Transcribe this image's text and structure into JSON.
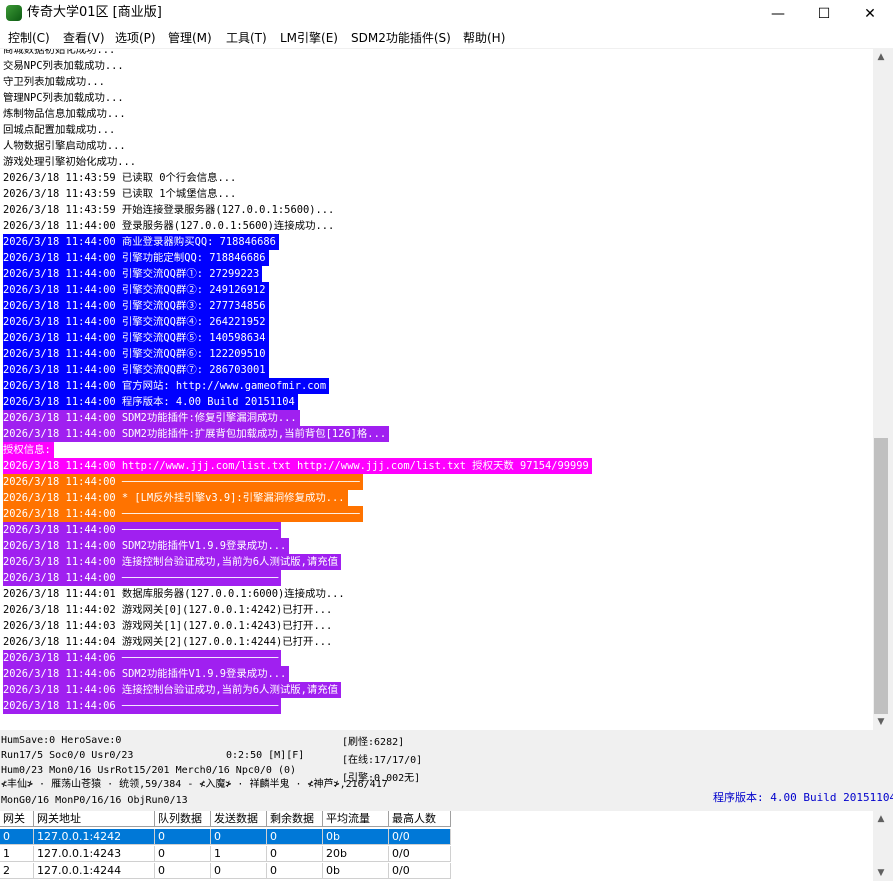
{
  "window": {
    "title": "传奇大学01区 [商业版]",
    "minimize": "—",
    "maximize": "☐",
    "close": "✕"
  },
  "menu": [
    {
      "label": "控制(C)"
    },
    {
      "label": "查看(V)"
    },
    {
      "label": "选项(P)"
    },
    {
      "label": "管理(M)"
    },
    {
      "label": "工具(T)"
    },
    {
      "label": "LM引擎(E)"
    },
    {
      "label": "SDM2功能插件(S)"
    },
    {
      "label": "帮助(H)"
    }
  ],
  "log": [
    {
      "text": "商城数据初始化成功...",
      "fg": "#000000",
      "bg": "#ffffff"
    },
    {
      "text": "交易NPC列表加载成功...",
      "fg": "#000000",
      "bg": "#ffffff"
    },
    {
      "text": "守卫列表加载成功...",
      "fg": "#000000",
      "bg": "#ffffff"
    },
    {
      "text": "管理NPC列表加载成功...",
      "fg": "#000000",
      "bg": "#ffffff"
    },
    {
      "text": "炼制物品信息加载成功...",
      "fg": "#000000",
      "bg": "#ffffff"
    },
    {
      "text": "回城点配置加载成功...",
      "fg": "#000000",
      "bg": "#ffffff"
    },
    {
      "text": "人物数据引擎启动成功...",
      "fg": "#000000",
      "bg": "#ffffff"
    },
    {
      "text": "游戏处理引擎初始化成功...",
      "fg": "#000000",
      "bg": "#ffffff"
    },
    {
      "text": "2026/3/18 11:43:59 已读取 0个行会信息...",
      "fg": "#000000",
      "bg": "#ffffff"
    },
    {
      "text": "2026/3/18 11:43:59 已读取 1个城堡信息...",
      "fg": "#000000",
      "bg": "#ffffff"
    },
    {
      "text": "2026/3/18 11:43:59 开始连接登录服务器(127.0.0.1:5600)...",
      "fg": "#000000",
      "bg": "#ffffff"
    },
    {
      "text": "2026/3/18 11:44:00 登录服务器(127.0.0.1:5600)连接成功...",
      "fg": "#000000",
      "bg": "#ffffff"
    },
    {
      "text": "2026/3/18 11:44:00 商业登录器购买QQ: 718846686",
      "fg": "#ffffff",
      "bg": "#0000ff"
    },
    {
      "text": "2026/3/18 11:44:00 引擎功能定制QQ: 718846686",
      "fg": "#ffffff",
      "bg": "#0000ff"
    },
    {
      "text": "2026/3/18 11:44:00 引擎交流QQ群①: 27299223",
      "fg": "#ffffff",
      "bg": "#0000ff"
    },
    {
      "text": "2026/3/18 11:44:00 引擎交流QQ群②: 249126912",
      "fg": "#ffffff",
      "bg": "#0000ff"
    },
    {
      "text": "2026/3/18 11:44:00 引擎交流QQ群③: 277734856",
      "fg": "#ffffff",
      "bg": "#0000ff"
    },
    {
      "text": "2026/3/18 11:44:00 引擎交流QQ群④: 264221952",
      "fg": "#ffffff",
      "bg": "#0000ff"
    },
    {
      "text": "2026/3/18 11:44:00 引擎交流QQ群⑤: 140598634",
      "fg": "#ffffff",
      "bg": "#0000ff"
    },
    {
      "text": "2026/3/18 11:44:00 引擎交流QQ群⑥: 122209510",
      "fg": "#ffffff",
      "bg": "#0000ff"
    },
    {
      "text": "2026/3/18 11:44:00 引擎交流QQ群⑦: 286703001",
      "fg": "#ffffff",
      "bg": "#0000ff"
    },
    {
      "text": "2026/3/18 11:44:00 官方网站: http://www.gameofmir.com",
      "fg": "#ffffff",
      "bg": "#0000ff"
    },
    {
      "text": "2026/3/18 11:44:00 程序版本: 4.00 Build 20151104",
      "fg": "#ffffff",
      "bg": "#0000ff"
    },
    {
      "text": "2026/3/18 11:44:00 SDM2功能插件:修复引擎漏洞成功...",
      "fg": "#ffffff",
      "bg": "#a020f0"
    },
    {
      "text": "2026/3/18 11:44:00 SDM2功能插件:扩展背包加载成功,当前背包[126]格...",
      "fg": "#ffffff",
      "bg": "#a020f0"
    },
    {
      "text": "授权信息:",
      "fg": "#ffffff",
      "bg": "#ff00ff"
    },
    {
      "text": "2026/3/18 11:44:00 http://www.jjj.com/list.txt http://www.jjj.com/list.txt 授权天数 97154/99999",
      "fg": "#ffffff",
      "bg": "#ff00ff"
    },
    {
      "text": "2026/3/18 11:44:00 ──────────────────────────────────────",
      "fg": "#ffffff",
      "bg": "#ff7300"
    },
    {
      "text": "2026/3/18 11:44:00 * [LM反外挂引擎v3.9]:引擎漏洞修复成功...",
      "fg": "#ffffff",
      "bg": "#ff7300"
    },
    {
      "text": "2026/3/18 11:44:00 ──────────────────────────────────────",
      "fg": "#ffffff",
      "bg": "#ff7300"
    },
    {
      "text": "2026/3/18 11:44:00 ─────────────────────────",
      "fg": "#ffffff",
      "bg": "#a020f0"
    },
    {
      "text": "2026/3/18 11:44:00 SDM2功能插件V1.9.9登录成功...",
      "fg": "#ffffff",
      "bg": "#a020f0"
    },
    {
      "text": "2026/3/18 11:44:00 连接控制台验证成功,当前为6人测试版,请充值",
      "fg": "#ffffff",
      "bg": "#a020f0"
    },
    {
      "text": "2026/3/18 11:44:00 ─────────────────────────",
      "fg": "#ffffff",
      "bg": "#a020f0"
    },
    {
      "text": "2026/3/18 11:44:01 数据库服务器(127.0.0.1:6000)连接成功...",
      "fg": "#000000",
      "bg": "#ffffff"
    },
    {
      "text": "2026/3/18 11:44:02 游戏网关[0](127.0.0.1:4242)已打开...",
      "fg": "#000000",
      "bg": "#ffffff"
    },
    {
      "text": "2026/3/18 11:44:03 游戏网关[1](127.0.0.1:4243)已打开...",
      "fg": "#000000",
      "bg": "#ffffff"
    },
    {
      "text": "2026/3/18 11:44:04 游戏网关[2](127.0.0.1:4244)已打开...",
      "fg": "#000000",
      "bg": "#ffffff"
    },
    {
      "text": "2026/3/18 11:44:06 ─────────────────────────",
      "fg": "#ffffff",
      "bg": "#a020f0"
    },
    {
      "text": "2026/3/18 11:44:06 SDM2功能插件V1.9.9登录成功...",
      "fg": "#ffffff",
      "bg": "#a020f0"
    },
    {
      "text": "2026/3/18 11:44:06 连接控制台验证成功,当前为6人测试版,请充值",
      "fg": "#ffffff",
      "bg": "#a020f0"
    },
    {
      "text": "2026/3/18 11:44:06 ─────────────────────────",
      "fg": "#ffffff",
      "bg": "#a020f0"
    }
  ],
  "status": {
    "line1": "HumSave:0 HeroSave:0",
    "line2": "Run17/5 Soc0/0 Usr0/23",
    "time": "0:2:50 [M][F]",
    "line3": "Hum0/23 Mon0/16 UsrRot15/201 Merch0/16 Npc0/0 (0)",
    "line4": "≮丰仙≯ · 雁荡山苍猿 · 统领,59/384 - ≮入魔≯ · 祥麟半鬼 · ≮神芦≯,216/417",
    "line5": "MonG0/16 MonP0/16/16 ObjRun0/13",
    "refresh": "[刷怪:6282]",
    "online": "[在线:17/17/0]",
    "engine": "[引擎:0.002无]",
    "version": "程序版本: 4.00 Build 20151104",
    "version_color": "#0000cc"
  },
  "gateway_table": {
    "headers": [
      "网关",
      "网关地址",
      "队列数据",
      "发送数据",
      "剩余数据",
      "平均流量",
      "最高人数"
    ],
    "rows": [
      [
        "0",
        "127.0.0.1:4242",
        "0",
        "0",
        "0",
        "0b",
        "0/0"
      ],
      [
        "1",
        "127.0.0.1:4243",
        "0",
        "1",
        "0",
        "20b",
        "0/0"
      ],
      [
        "2",
        "127.0.0.1:4244",
        "0",
        "0",
        "0",
        "0b",
        "0/0"
      ]
    ],
    "selected_bg": "#0078d7"
  }
}
